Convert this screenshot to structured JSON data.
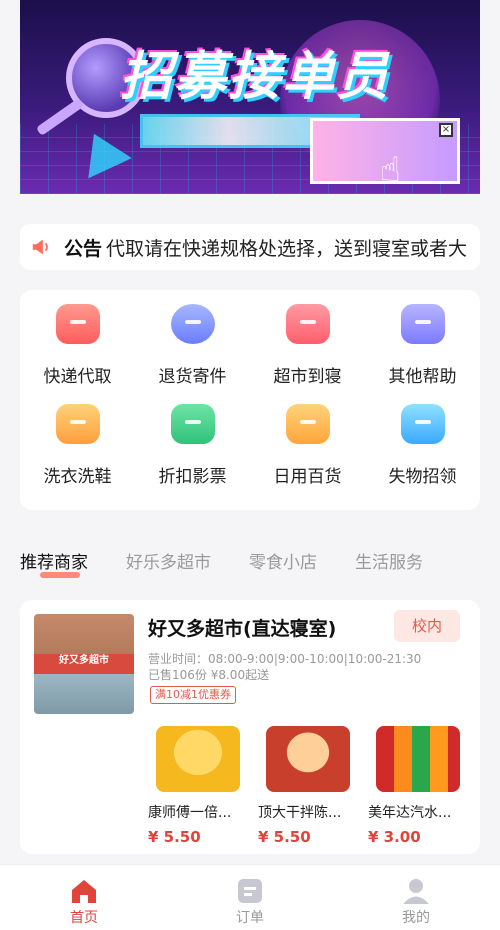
{
  "banner": {
    "title": "招募接单员"
  },
  "notice": {
    "label": "公告",
    "text": "代取请在快递规格处选择，送到寝室或者大"
  },
  "services": [
    {
      "label": "快递代取",
      "icon": "package-icon",
      "color": "#ff6b6b"
    },
    {
      "label": "退货寄件",
      "icon": "courier-icon",
      "color": "#7b8bff"
    },
    {
      "label": "超市到寝",
      "icon": "store-icon",
      "color": "#ff6370"
    },
    {
      "label": "其他帮助",
      "icon": "calendar-icon",
      "color": "#8a88ff"
    },
    {
      "label": "洗衣洗鞋",
      "icon": "shirt-icon",
      "color": "#ffae4a"
    },
    {
      "label": "折扣影票",
      "icon": "ticket-icon",
      "color": "#3fcd86"
    },
    {
      "label": "日用百货",
      "icon": "shopping-bag-icon",
      "color": "#ffb04a"
    },
    {
      "label": "失物招领",
      "icon": "search-box-icon",
      "color": "#4cb4ff"
    }
  ],
  "tabs": [
    {
      "label": "推荐商家",
      "active": true
    },
    {
      "label": "好乐多超市",
      "active": false
    },
    {
      "label": "零食小店",
      "active": false
    },
    {
      "label": "生活服务",
      "active": false
    }
  ],
  "store": {
    "name": "好又多超市(直达寝室)",
    "badge": "校内",
    "photo_sign": "好又多超市",
    "hours": "营业时间：08:00-9:00|9:00-10:00|10:00-21:30",
    "sold": "已售106份 ¥8.00起送",
    "coupon": "满10减1优惠券",
    "products": [
      {
        "name": "康师傅一倍...",
        "price": "¥ 5.50"
      },
      {
        "name": "顶大干拌陈...",
        "price": "¥ 5.50"
      },
      {
        "name": "美年达汽水...",
        "price": "¥ 3.00"
      }
    ]
  },
  "nav": [
    {
      "label": "首页",
      "active": true,
      "icon": "home-icon"
    },
    {
      "label": "订单",
      "active": false,
      "icon": "order-icon"
    },
    {
      "label": "我的",
      "active": false,
      "icon": "user-icon"
    }
  ],
  "colors": {
    "accent": "#e0443a",
    "tab_underline": "#ff8a7a",
    "badge_bg": "#ffe8e4"
  }
}
